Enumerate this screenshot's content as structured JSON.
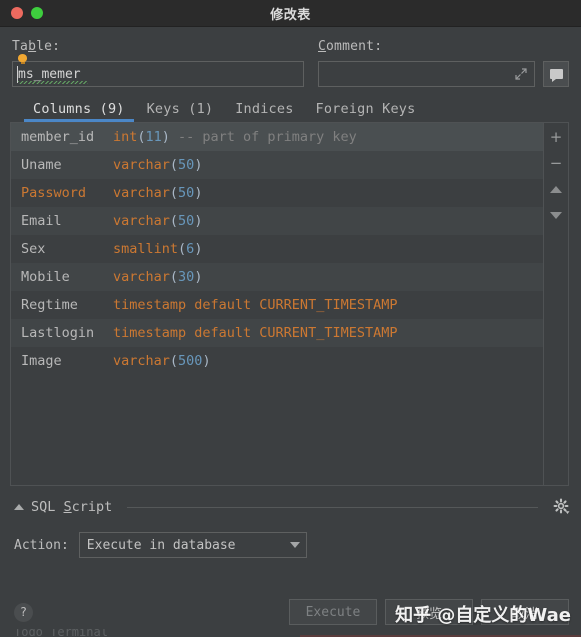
{
  "window": {
    "title": "修改表",
    "controls": [
      "close",
      "maximize"
    ]
  },
  "fields": {
    "table_label": "Table:",
    "table_label_mnemonic": "b",
    "table_value": "ms_memer",
    "comment_label": "Comment:",
    "comment_label_mnemonic": "C",
    "comment_value": "",
    "comment_expand_icon": "expand-icon",
    "comment_button_icon": "speech-bubble-icon",
    "intention_icon": "lightbulb-icon"
  },
  "tabs": [
    {
      "label": "Columns (9)",
      "active": true
    },
    {
      "label": "Keys (1)",
      "active": false
    },
    {
      "label": "Indices",
      "active": false
    },
    {
      "label": "Foreign Keys",
      "active": false
    }
  ],
  "columns": [
    {
      "name": "member_id",
      "name_keyword": false,
      "type": "int",
      "size": "11",
      "comment": "-- part of primary key",
      "selected": true
    },
    {
      "name": "Uname",
      "name_keyword": false,
      "type": "varchar",
      "size": "50",
      "comment": "",
      "selected": false
    },
    {
      "name": "Password",
      "name_keyword": true,
      "type": "varchar",
      "size": "50",
      "comment": "",
      "selected": false
    },
    {
      "name": "Email",
      "name_keyword": false,
      "type": "varchar",
      "size": "50",
      "comment": "",
      "selected": false
    },
    {
      "name": "Sex",
      "name_keyword": false,
      "type": "smallint",
      "size": "6",
      "comment": "",
      "selected": false
    },
    {
      "name": "Mobile",
      "name_keyword": false,
      "type": "varchar",
      "size": "30",
      "comment": "",
      "selected": false
    },
    {
      "name": "Regtime",
      "name_keyword": false,
      "type": "timestamp default CURRENT_TIMESTAMP",
      "size": "",
      "comment": "",
      "selected": false
    },
    {
      "name": "Lastlogin",
      "name_keyword": false,
      "type": "timestamp default CURRENT_TIMESTAMP",
      "size": "",
      "comment": "",
      "selected": false
    },
    {
      "name": "Image",
      "name_keyword": false,
      "type": "varchar",
      "size": "500",
      "comment": "",
      "selected": false
    }
  ],
  "table_toolbar": [
    {
      "icon": "plus-icon",
      "label": "+"
    },
    {
      "icon": "minus-icon",
      "label": "−"
    },
    {
      "icon": "move-up-icon",
      "label": ""
    },
    {
      "icon": "move-down-icon",
      "label": ""
    }
  ],
  "sql_section": {
    "title": "SQL Script",
    "title_mnemonic": "S",
    "collapsed": false,
    "settings_icon": "gear-icon",
    "action_label": "Action:",
    "action_value": "Execute in database"
  },
  "footer": {
    "help_label": "?",
    "buttons": [
      {
        "label": "Execute",
        "disabled": true
      },
      {
        "label": "预览",
        "disabled": false
      },
      {
        "label": "取消",
        "disabled": false
      }
    ]
  },
  "watermark": "知乎 @自定义的Wae",
  "bottom_cutoff_text": "Todo     Terminal",
  "colors": {
    "accent": "#4b87c7",
    "keyword": "#cc7832",
    "number": "#6897bb",
    "comment": "#808080",
    "background": "#3c3f41",
    "titlebar": "#2b2b2b"
  }
}
